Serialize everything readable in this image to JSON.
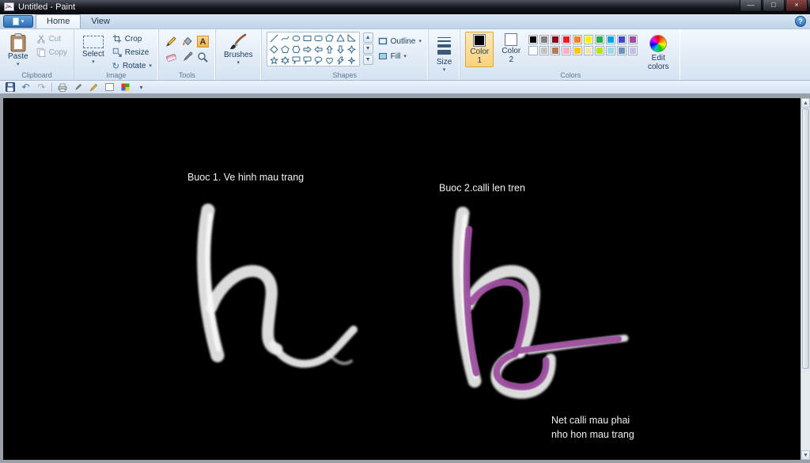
{
  "window": {
    "title": "Untitled - Paint"
  },
  "icons": {
    "dropdown": "▾",
    "minimize": "—",
    "maximize": "□",
    "close": "×",
    "help": "?",
    "undo": "↶",
    "redo": "↷",
    "rotate": "↻",
    "scroll_up": "▲",
    "scroll_down": "▼",
    "gallery_up": "▲",
    "gallery_down": "▼",
    "gallery_more": "▼"
  },
  "menu": {
    "tabs": [
      {
        "label": "Home",
        "active": true
      },
      {
        "label": "View",
        "active": false
      }
    ]
  },
  "ribbon": {
    "clipboard": {
      "group_label": "Clipboard",
      "paste": "Paste",
      "cut": "Cut",
      "copy": "Copy"
    },
    "image": {
      "group_label": "Image",
      "select": "Select",
      "crop": "Crop",
      "resize": "Resize",
      "rotate": "Rotate"
    },
    "tools": {
      "group_label": "Tools",
      "text_tool_glyph": "A"
    },
    "brushes": {
      "label": "Brushes"
    },
    "shapes": {
      "group_label": "Shapes",
      "outline": "Outline",
      "fill": "Fill"
    },
    "size": {
      "label": "Size"
    },
    "colors": {
      "group_label": "Colors",
      "color1_label": "Color 1",
      "color2_label": "Color 2",
      "edit_colors_label": "Edit colors",
      "color1_value": "#000000",
      "color2_value": "#ffffff",
      "palette": [
        [
          "#000000",
          "#7f7f7f",
          "#880015",
          "#ed1c24",
          "#ff7f27",
          "#fff200",
          "#22b14c",
          "#00a2e8",
          "#3f48cc",
          "#a349a4"
        ],
        [
          "#ffffff",
          "#c3c3c3",
          "#b97a57",
          "#ffaec9",
          "#ffc90e",
          "#efe4b0",
          "#b5e61d",
          "#99d9ea",
          "#7092be",
          "#c8bfe7"
        ]
      ]
    }
  },
  "canvas": {
    "background": "#000000",
    "annotations": {
      "step1": "Buoc 1. Ve hinh mau trang",
      "step2": "Buoc 2.calli len tren",
      "note_line1": "Net calli mau phai",
      "note_line2": "nho hon mau trang"
    },
    "stroke_colors": {
      "white": "#ededed",
      "purple": "#9d4f9f"
    }
  }
}
